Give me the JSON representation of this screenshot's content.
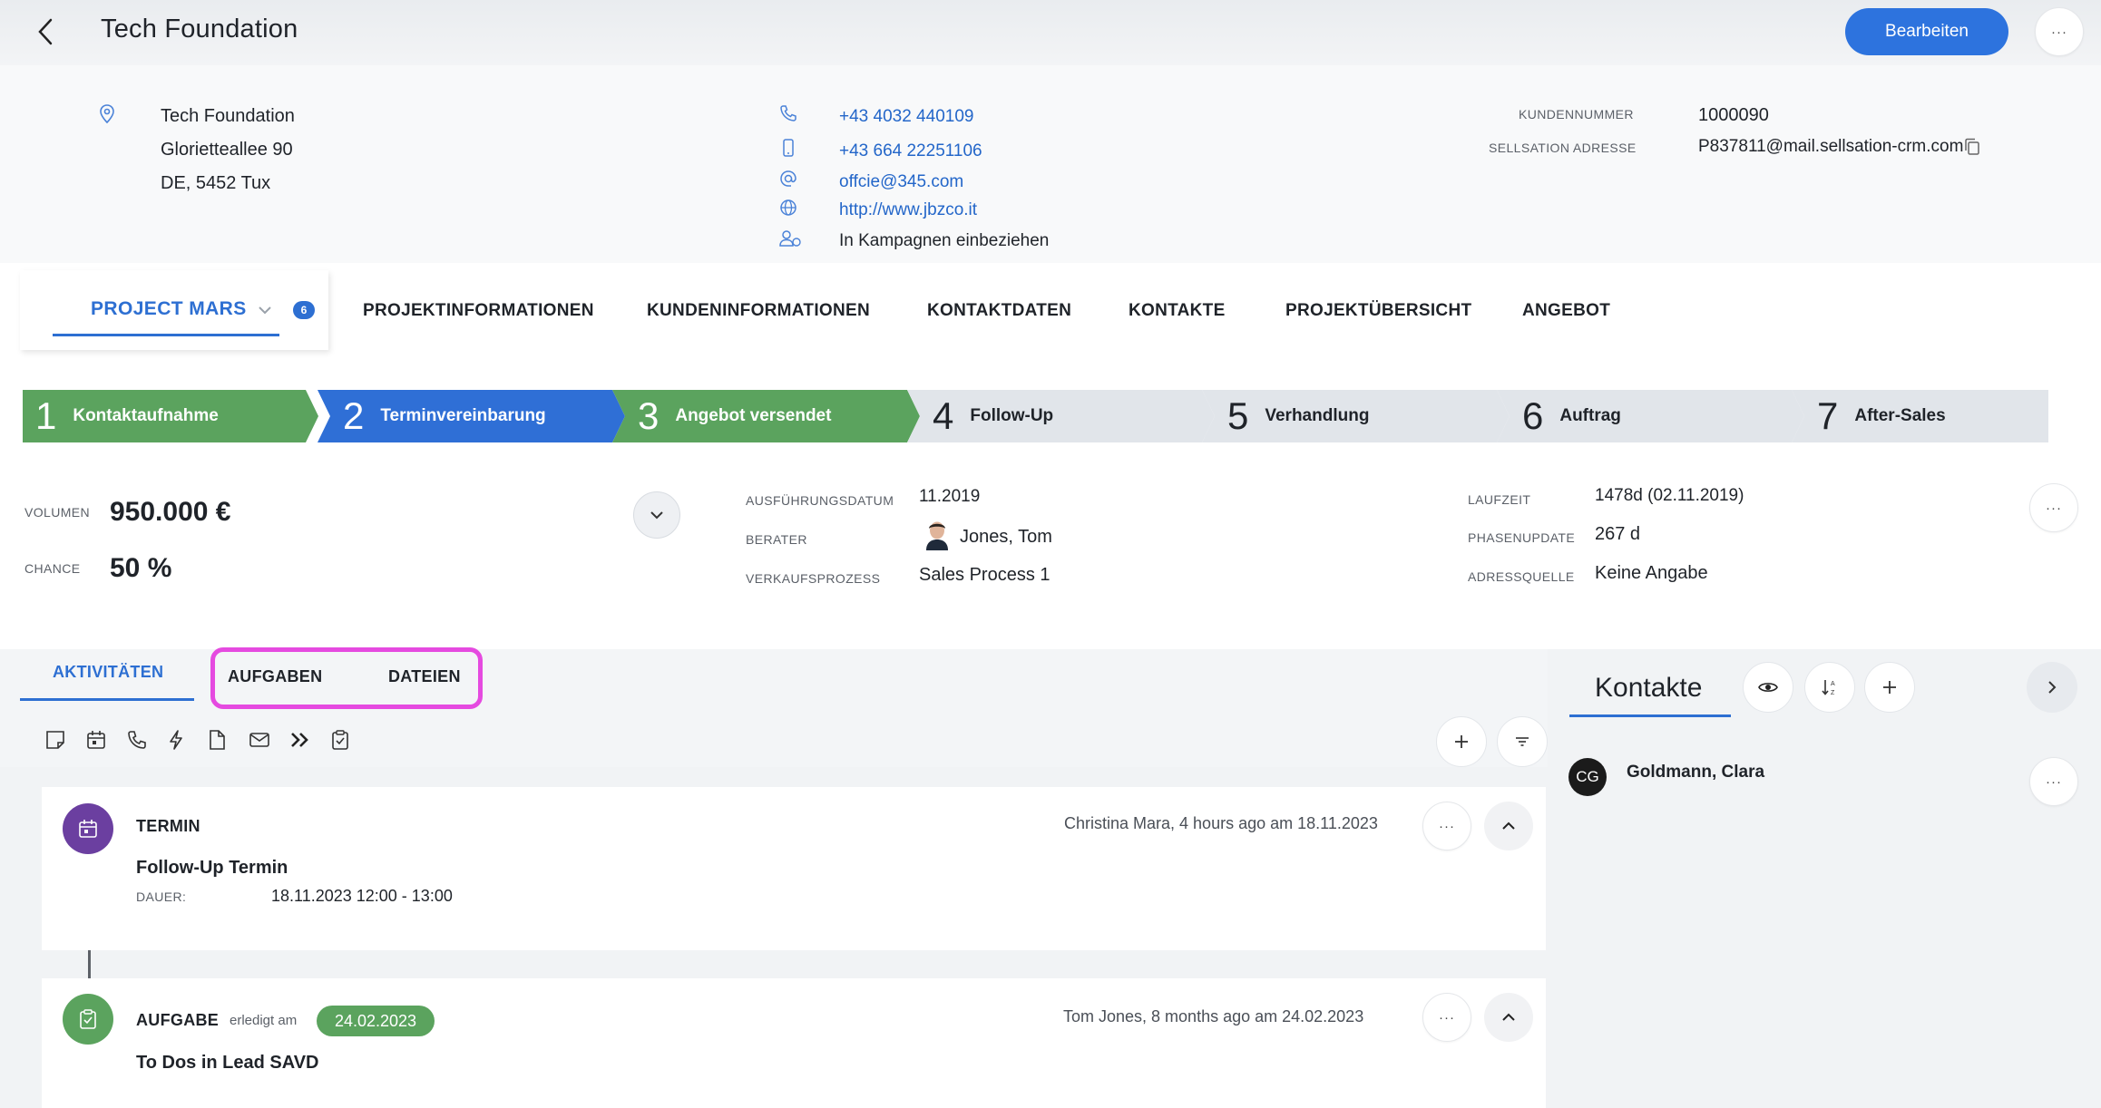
{
  "header": {
    "title": "Tech Foundation",
    "edit_label": "Bearbeiten",
    "more_label": "···"
  },
  "company": {
    "address": [
      "Tech Foundation",
      "Glorietteallee 90",
      "DE, 5452 Tux"
    ],
    "phone": "+43 4032 440109",
    "mobile": "+43 664 22251106",
    "email": "offcie@345.com",
    "website": "http://www.jbzco.it",
    "campaign": "In Kampagnen einbeziehen",
    "customer_number_label": "KUNDENNUMMER",
    "customer_number": "1000090",
    "sellsation_label": "SELLSATION ADRESSE",
    "sellsation_address": "P837811@mail.sellsation-crm.com"
  },
  "tabs": {
    "project": "PROJECT MARS",
    "project_badge": "6",
    "items": [
      "PROJEKTINFORMATIONEN",
      "KUNDENINFORMATIONEN",
      "KONTAKTDATEN",
      "KONTAKTE",
      "PROJEKTÜBERSICHT",
      "ANGEBOT"
    ]
  },
  "stages": [
    {
      "num": "1",
      "label": "Kontaktaufnahme",
      "status": "done",
      "color": "#5ba35e"
    },
    {
      "num": "2",
      "label": "Terminvereinbarung",
      "status": "current",
      "color": "#2f6fd6"
    },
    {
      "num": "3",
      "label": "Angebot versendet",
      "status": "done",
      "color": "#5ba35e"
    },
    {
      "num": "4",
      "label": "Follow-Up",
      "status": "open",
      "color": "#e1e5ea"
    },
    {
      "num": "5",
      "label": "Verhandlung",
      "status": "open",
      "color": "#e1e5ea"
    },
    {
      "num": "6",
      "label": "Auftrag",
      "status": "open",
      "color": "#e1e5ea"
    },
    {
      "num": "7",
      "label": "After-Sales",
      "status": "open",
      "color": "#e1e5ea"
    }
  ],
  "project": {
    "volume_label": "VOLUMEN",
    "volume": "950.000 €",
    "chance_label": "CHANCE",
    "chance": "50 %",
    "exec_date_label": "AUSFÜHRUNGSDATUM",
    "exec_date": "11.2019",
    "advisor_label": "BERATER",
    "advisor": "Jones, Tom",
    "process_label": "VERKAUFSPROZESS",
    "process": "Sales Process 1",
    "runtime_label": "LAUFZEIT",
    "runtime": "1478d (02.11.2019)",
    "phase_update_label": "PHASENUPDATE",
    "phase_update": "267 d",
    "address_source_label": "ADRESSQUELLE",
    "address_source": "Keine Angabe"
  },
  "activity_tabs": {
    "activities": "AKTIVITÄTEN",
    "tasks": "AUFGABEN",
    "files": "DATEIEN"
  },
  "activities": [
    {
      "type": "TERMIN",
      "title": "Follow-Up Termin",
      "meta": "Christina Mara, 4 hours ago am 18.11.2023",
      "duration_label": "DAUER:",
      "duration": "18.11.2023 12:00 - 13:00",
      "color": "#6b3fa0"
    },
    {
      "type": "AUFGABE",
      "done_label": "erledigt am",
      "done_date": "24.02.2023",
      "title": "To Dos in Lead SAVD",
      "meta": "Tom Jones, 8 months ago am 24.02.2023",
      "color": "#5ba35e"
    }
  ],
  "contacts": {
    "title": "Kontakte",
    "items": [
      {
        "initials": "CG",
        "name": "Goldmann, Clara"
      }
    ]
  },
  "colors": {
    "accent": "#2d6fd2",
    "highlight": "#e54ae0",
    "success": "#5ba35e"
  }
}
